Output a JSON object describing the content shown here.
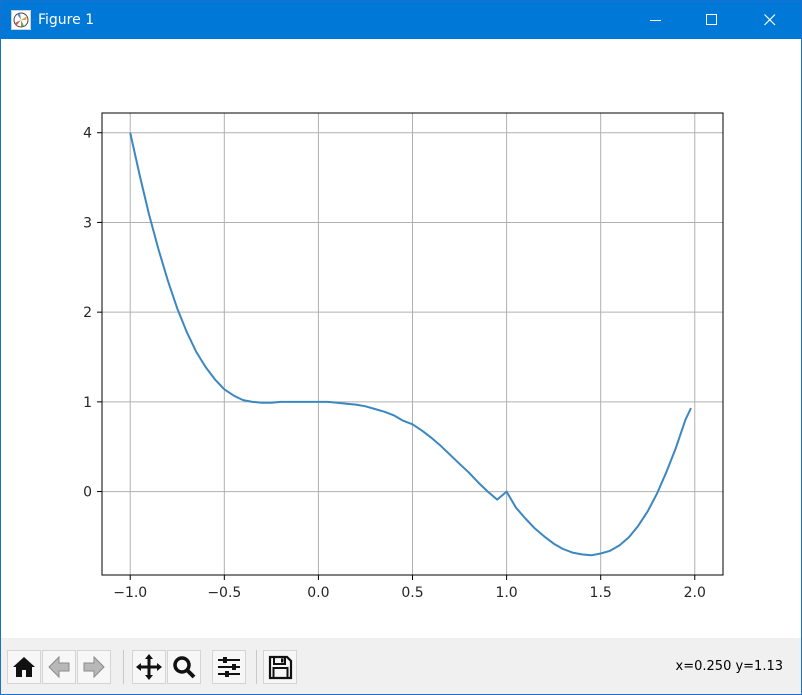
{
  "window": {
    "title": "Figure 1",
    "icon": "matplotlib-figure-icon",
    "controls": [
      "minimize-icon",
      "maximize-icon",
      "close-icon"
    ]
  },
  "toolbar": {
    "buttons": [
      {
        "name": "home-button",
        "icon": "home-icon"
      },
      {
        "name": "back-button",
        "icon": "back-arrow-icon"
      },
      {
        "name": "forward-button",
        "icon": "forward-arrow-icon"
      },
      {
        "name": "pan-button",
        "icon": "move-icon"
      },
      {
        "name": "zoom-button",
        "icon": "magnifier-icon"
      },
      {
        "name": "subplots-button",
        "icon": "sliders-icon"
      },
      {
        "name": "save-button",
        "icon": "floppy-disk-icon"
      }
    ],
    "coords": "x=0.250 y=1.13"
  },
  "colors": {
    "titlebar": "#0078d7",
    "line": "#3b87c0",
    "grid": "#b0b0b0",
    "toolbar_bg": "#f0f0f0"
  },
  "chart_data": {
    "type": "line",
    "title": "",
    "xlabel": "",
    "ylabel": "",
    "xlim": [
      -1.15,
      2.15
    ],
    "ylim": [
      -0.93,
      4.22
    ],
    "xticks": [
      -1.0,
      -0.5,
      0.0,
      0.5,
      1.0,
      1.5,
      2.0
    ],
    "xtick_labels": [
      "−1.0",
      "−0.5",
      "0.0",
      "0.5",
      "1.0",
      "1.5",
      "2.0"
    ],
    "yticks": [
      0,
      1,
      2,
      3,
      4
    ],
    "ytick_labels": [
      "0",
      "1",
      "2",
      "3",
      "4"
    ],
    "grid": true,
    "series": [
      {
        "x": [
          -1.0,
          -0.95,
          -0.9,
          -0.85,
          -0.8,
          -0.75,
          -0.7,
          -0.65,
          -0.6,
          -0.55,
          -0.5,
          -0.45,
          -0.4,
          -0.35,
          -0.3,
          -0.25,
          -0.2,
          -0.15,
          -0.1,
          -0.05,
          0.0,
          0.05,
          0.1,
          0.15,
          0.2,
          0.25,
          0.3,
          0.35,
          0.4,
          0.45,
          0.5,
          0.55,
          0.6,
          0.65,
          0.7,
          0.75,
          0.8,
          0.85,
          0.9,
          0.95,
          1.0,
          1.05,
          1.1,
          1.15,
          1.2,
          1.25,
          1.3,
          1.35,
          1.4,
          1.45,
          1.5,
          1.55,
          1.6,
          1.65,
          1.7,
          1.75,
          1.8,
          1.85,
          1.9,
          1.95,
          1.98
        ],
        "y": [
          4.0,
          3.53,
          3.09,
          2.7,
          2.35,
          2.04,
          1.78,
          1.56,
          1.39,
          1.25,
          1.14,
          1.07,
          1.02,
          1.0,
          0.99,
          0.99,
          1.0,
          1.0,
          1.0,
          1.0,
          1.0,
          1.0,
          0.99,
          0.98,
          0.97,
          0.95,
          0.92,
          0.89,
          0.85,
          0.79,
          0.75,
          0.68,
          0.6,
          0.51,
          0.41,
          0.31,
          0.21,
          0.1,
          0.0,
          -0.09,
          -0.0,
          -0.18,
          -0.3,
          -0.41,
          -0.5,
          -0.58,
          -0.64,
          -0.68,
          -0.7,
          -0.71,
          -0.69,
          -0.66,
          -0.6,
          -0.51,
          -0.38,
          -0.22,
          -0.02,
          0.22,
          0.49,
          0.8,
          0.93
        ]
      }
    ]
  }
}
